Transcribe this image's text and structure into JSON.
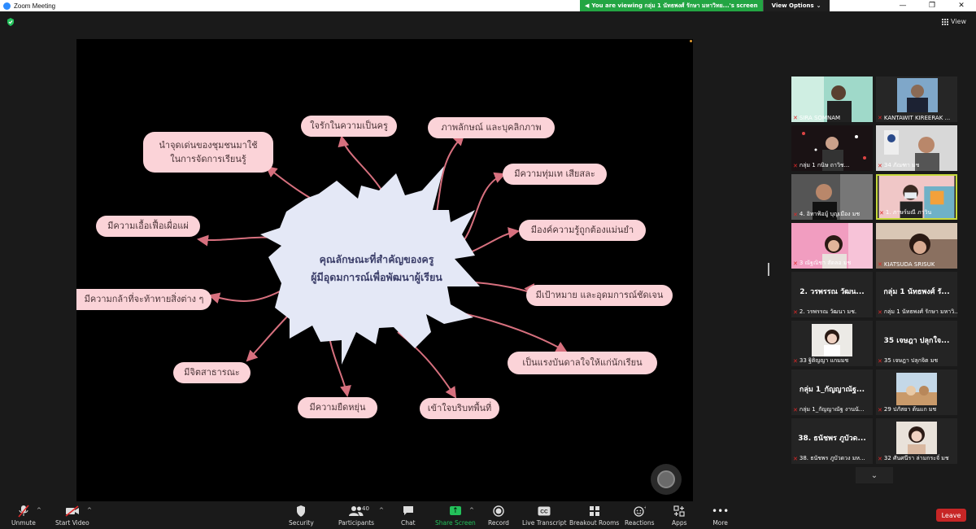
{
  "window": {
    "title": "Zoom Meeting"
  },
  "share_bar": {
    "message": "You are viewing กลุ่ม 1 นัทธพงศ์ รักษา มหาวิทย...'s screen",
    "view_options": "View Options"
  },
  "top": {
    "view_label": "View"
  },
  "mindmap": {
    "center_line1": "คุณลักษณะที่สำคัญของครู",
    "center_line2": "ผู้มีอุดมการณ์เพื่อพัฒนาผู้เรียน",
    "nodes": [
      "ใจรักในความเป็นครู",
      "ภาพลักษณ์ และบุคลิกภาพ",
      "มีความทุ่มเท เสียสละ",
      "มีองค์ความรู้ถูกต้องแม่นยำ",
      "มีเป้าหมาย และอุดมการณ์ชัดเจน",
      "เป็นแรงบันดาลใจให้แก่นักเรียน",
      "เข้าใจบริบทพื้นที่",
      "มีความยืดหยุ่น",
      "มีจิตสาธารณะ",
      "มีความกล้าที่จะท้าทายสิ่งต่าง ๆ",
      "มีความเอื้อเฟื้อเผื่อแผ่",
      "นำจุดเด่นของชุมชนมาใช้",
      "ในการจัดการเรียนรู้"
    ]
  },
  "participants": [
    {
      "name": "SIRA SOMNAM",
      "big": ""
    },
    {
      "name": "KANTAWIT KIREERAK ...",
      "big": ""
    },
    {
      "name": "กลุ่ม 1 กนิษ ถาวิช...",
      "big": ""
    },
    {
      "name": "34 ภัณฑา มช",
      "big": ""
    },
    {
      "name": "4. อิทาฟ้อมู้ บุญเมือง มช",
      "big": ""
    },
    {
      "name": "1. ภาษร์มณี ภาวิน",
      "big": ""
    },
    {
      "name": "3 ณัฐณิชา สัดลอ มช",
      "big": ""
    },
    {
      "name": "KIATSUDA SRISUK",
      "big": ""
    },
    {
      "name": "2. วรพรรณ วัฒนา มช.",
      "big": "2. วรพรรณ วัฒน..."
    },
    {
      "name": "กลุ่ม 1 นัทธพงศ์ รักษา มหาวิ...",
      "big": "กลุ่ม 1 นัทธพงศ์ รั..."
    },
    {
      "name": "33 ฐิติญญา แกมมช",
      "big": ""
    },
    {
      "name": "35 เจษฎา ปลุกจิต มช",
      "big": "35 เจษฎา ปลุกใจ..."
    },
    {
      "name": "กลุ่ม 1_กัญญาณัฐ งานนั...",
      "big": "กลุ่ม 1_กัญญาณัฐ..."
    },
    {
      "name": "29 ปภัสยา ต้นแก มช",
      "big": ""
    },
    {
      "name": "38. ธนัชพร ภูบัวดวง มห...",
      "big": "38. ธนัชพร ภูบัวด..."
    },
    {
      "name": "32 ศันศนีรา ล่ามกระจั่ มช",
      "big": ""
    }
  ],
  "toolbar": {
    "unmute": "Unmute",
    "start_video": "Start Video",
    "security": "Security",
    "participants": "Participants",
    "participants_count": "40",
    "chat": "Chat",
    "share_screen": "Share Screen",
    "record": "Record",
    "live_transcript": "Live Transcript",
    "breakout_rooms": "Breakout Rooms",
    "reactions": "Reactions",
    "apps": "Apps",
    "more": "More",
    "leave": "Leave"
  },
  "icons": {
    "cc": "CC"
  },
  "colors": {
    "node_fill": "#fbd3d8",
    "arrow": "#d7707e",
    "splash": "#e4e8f6",
    "share_green": "#23a543",
    "leave_red": "#c72626"
  }
}
